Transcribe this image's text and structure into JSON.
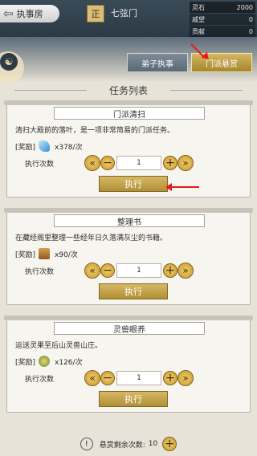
{
  "header": {
    "back_label": "执事房",
    "sect_badge": "正",
    "sect_name": "七弦门",
    "stats": [
      {
        "label": "灵石",
        "value": "2000"
      },
      {
        "label": "威望",
        "value": "0"
      },
      {
        "label": "贡献",
        "value": "0"
      }
    ]
  },
  "tabs": [
    {
      "label": "弟子执事"
    },
    {
      "label": "门派悬赏"
    }
  ],
  "list_title": "任务列表",
  "tasks": [
    {
      "title": "门派清扫",
      "desc": "清扫大殿前的落叶，是一项非常简易的门派任务。",
      "reward_label": "[奖励]",
      "reward_text": "x378/次",
      "times_label": "执行次数",
      "count": "1",
      "exec_label": "执行"
    },
    {
      "title": "整理书",
      "desc": "在藏经阁里整理一些经年日久落满灰尘的书籍。",
      "reward_label": "[奖励]",
      "reward_text": "x90/次",
      "times_label": "执行次数",
      "count": "1",
      "exec_label": "执行"
    },
    {
      "title": "灵兽眼养",
      "desc": "运送灵果至后山灵兽山庄。",
      "reward_label": "[奖励]",
      "reward_text": "x126/次",
      "times_label": "执行次数",
      "count": "1",
      "exec_label": "执行"
    }
  ],
  "footer": {
    "label": "悬赏剩余次数:",
    "value": "10"
  },
  "colors": {
    "accent_gold": "#c8962c",
    "annotation_red": "#e21b1b"
  }
}
